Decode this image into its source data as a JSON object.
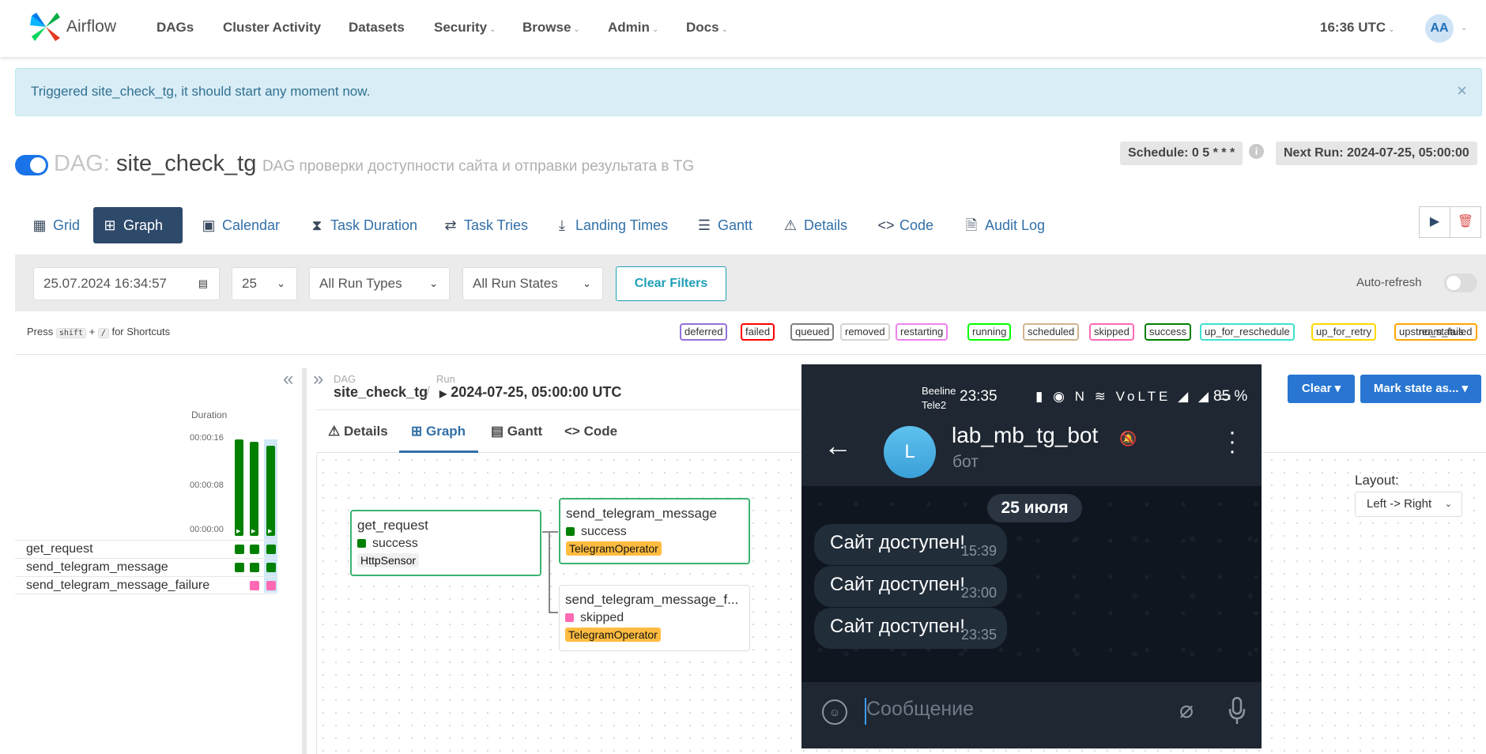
{
  "nav": {
    "brand": "Airflow",
    "items": [
      "DAGs",
      "Cluster Activity",
      "Datasets",
      "Security",
      "Browse",
      "Admin",
      "Docs"
    ],
    "clock": "16:36 UTC",
    "avatar": "AA"
  },
  "alert": {
    "text": "Triggered site_check_tg, it should start any moment now.",
    "close": "×"
  },
  "dag": {
    "prefix": "DAG:",
    "id": "site_check_tg",
    "description": "DAG проверки доступности сайта и отправки результата в TG",
    "schedule": "Schedule: 0 5 * * *",
    "next_run": "Next Run: 2024-07-25, 05:00:00"
  },
  "tabs": [
    "Grid",
    "Graph",
    "Calendar",
    "Task Duration",
    "Task Tries",
    "Landing Times",
    "Gantt",
    "Details",
    "Code",
    "Audit Log"
  ],
  "filters": {
    "base_date": "25.07.2024 16:34:57",
    "num_runs": "25",
    "run_type": "All Run Types",
    "run_state": "All Run States",
    "clear_label": "Clear Filters",
    "autorefresh_label": "Auto-refresh"
  },
  "shortcuts": {
    "press": "Press",
    "key1": "shift",
    "plus": "+",
    "key2": "/",
    "suffix": "for Shortcuts"
  },
  "legend": [
    {
      "label": "deferred",
      "color": "#9370db"
    },
    {
      "label": "failed",
      "color": "#ff0000"
    },
    {
      "label": "queued",
      "color": "#808080"
    },
    {
      "label": "removed",
      "color": "#d3d3d3"
    },
    {
      "label": "restarting",
      "color": "#ee82ee"
    },
    {
      "label": "running",
      "color": "#00ff00"
    },
    {
      "label": "scheduled",
      "color": "#d2b48c"
    },
    {
      "label": "skipped",
      "color": "#ff69b4"
    },
    {
      "label": "success",
      "color": "#008000"
    },
    {
      "label": "up_for_reschedule",
      "color": "#40e0d0"
    },
    {
      "label": "up_for_retry",
      "color": "#ffd700"
    },
    {
      "label": "upstream_failed",
      "color": "#ffa500"
    }
  ],
  "legend_no_status": "no_status",
  "grid": {
    "duration_label": "Duration",
    "ticks": [
      "00:00:16",
      "00:00:08",
      "00:00:00"
    ],
    "tasks": [
      "get_request",
      "send_telegram_message",
      "send_telegram_message_failure"
    ]
  },
  "details": {
    "dag_label": "DAG",
    "dag_id": "site_check_tg",
    "sep": "/",
    "run_label": "Run",
    "run_id": "2024-07-25, 05:00:00 UTC",
    "subtabs": [
      "Details",
      "Graph",
      "Gantt",
      "Code"
    ],
    "clear_btn": "Clear ▾",
    "mark_btn": "Mark state as... ▾",
    "layout_label": "Layout:",
    "layout_value": "Left -> Right"
  },
  "nodes": [
    {
      "title": "get_request",
      "state": "success",
      "operator": "HttpSensor",
      "state_color": "#008000",
      "op_color": "#f0f0f0"
    },
    {
      "title": "send_telegram_message",
      "state": "success",
      "operator": "TelegramOperator",
      "state_color": "#008000",
      "op_color": "#ffbc40"
    },
    {
      "title": "send_telegram_message_f...",
      "state": "skipped",
      "operator": "TelegramOperator",
      "state_color": "#ff69b4",
      "op_color": "#ffbc40"
    }
  ],
  "phone": {
    "carrier1": "Beeline",
    "carrier2": "Tele2",
    "time": "23:35",
    "status_icons": "▮ ◉ N ≋ VoLTE ◢ ◢ ▭",
    "battery": "85 %",
    "bot_initial": "L",
    "bot_name": "lab_mb_tg_bot",
    "bot_sub": "бот",
    "date_chip": "25 июля",
    "messages": [
      {
        "text": "Сайт доступен!",
        "time": "15:39"
      },
      {
        "text": "Сайт доступен!",
        "time": "23:00"
      },
      {
        "text": "Сайт доступен!",
        "time": "23:35"
      }
    ],
    "input_placeholder": "Сообщение"
  }
}
